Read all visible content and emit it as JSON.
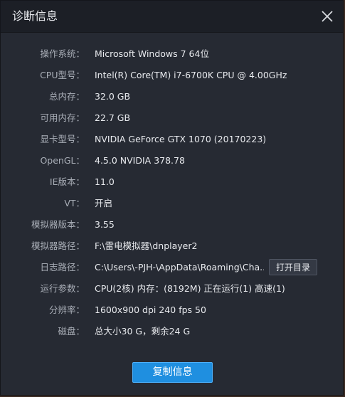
{
  "dialog": {
    "title": "诊断信息",
    "close_icon": "close-icon",
    "copy_label": "复制信息",
    "open_dir_label": "打开目录"
  },
  "rows": [
    {
      "label": "操作系统：",
      "value": "Microsoft Windows 7 64位"
    },
    {
      "label": "CPU型号：",
      "value": "Intel(R) Core(TM) i7-6700K CPU @ 4.00GHz"
    },
    {
      "label": "总内存：",
      "value": "32.0 GB"
    },
    {
      "label": "可用内存：",
      "value": "22.7 GB"
    },
    {
      "label": "显卡型号：",
      "value": "NVIDIA GeForce GTX 1070 (20170223)"
    },
    {
      "label": "OpenGL：",
      "value": "4.5.0 NVIDIA 378.78"
    },
    {
      "label": "IE版本：",
      "value": "11.0"
    },
    {
      "label": "VT：",
      "value": "开启"
    },
    {
      "label": "模拟器版本：",
      "value": "3.55"
    },
    {
      "label": "模拟器路径：",
      "value": "F:\\雷电模拟器\\dnplayer2"
    },
    {
      "label": "日志路径：",
      "value": "C:\\Users\\-PJH-\\AppData\\Roaming\\Cha..."
    },
    {
      "label": "运行参数：",
      "value": "CPU(2核) 内存：(8192M) 正在运行(1) 高速(1)"
    },
    {
      "label": "分辨率：",
      "value": "1600x900 dpi 240 fps 50"
    },
    {
      "label": "磁盘：",
      "value": "总大小30 G，剩余24 G"
    }
  ],
  "colors": {
    "accent": "#1f8fe0",
    "panel": "#262a33",
    "titlebar": "#1c1f26"
  }
}
